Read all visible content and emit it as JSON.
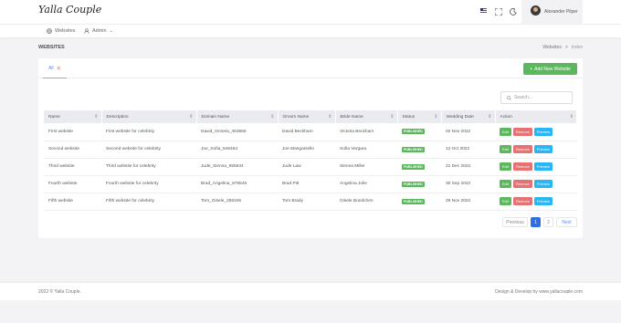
{
  "header": {
    "brand": "Yalla Couple",
    "user_name": "Alexander Pilper",
    "flag": "us-flag-icon"
  },
  "nav": {
    "websites": "Websites",
    "admin": "Admin"
  },
  "page": {
    "title": "WEBSITES",
    "breadcrumb": [
      "Websites",
      "Index"
    ]
  },
  "tabs": {
    "all_label": "All",
    "all_count": "5"
  },
  "add_button": "Add New Website",
  "search": {
    "placeholder": "Search..."
  },
  "table": {
    "columns": [
      "Name",
      "Description",
      "Domain Name",
      "Groom Name",
      "Bride Name",
      "Status",
      "Wedding Date",
      "Action"
    ],
    "rows": [
      {
        "name": "First website",
        "description": "First website for celebrity",
        "domain": "David_Victoria_453555",
        "groom": "David Beckham",
        "bride": "Victoria Beckham",
        "status": "PUBLISHED",
        "date": "02 Nov 2022"
      },
      {
        "name": "Second website",
        "description": "Second website for celebrity",
        "domain": "Joe_Sofia_546464",
        "groom": "Joe Manganiello",
        "bride": "Sofia Vergara",
        "status": "PUBLISHED",
        "date": "12 Oct 2022"
      },
      {
        "name": "Third website",
        "description": "Third website for celebrity",
        "domain": "Jude_Sienna_955634",
        "groom": "Jude Law",
        "bride": "Sienna Miller",
        "status": "PUBLISHED",
        "date": "21 Dec 2022"
      },
      {
        "name": "Fourth website",
        "description": "Fourth website for celebrity",
        "domain": "Brad_Angelina_876545",
        "groom": "Brad Pitt",
        "bride": "Angelina Jolie",
        "status": "PUBLISHED",
        "date": "30 Sep 2022"
      },
      {
        "name": "Fifth website",
        "description": "Fifth website for celebrity",
        "domain": "Tom_Gisele_256346",
        "groom": "Tom Brady",
        "bride": "Gisele Bundchen",
        "status": "PUBLISHED",
        "date": "29 Nov 2022"
      }
    ],
    "actions": {
      "edit": "Edit",
      "remove": "Remove",
      "preview": "Preview"
    }
  },
  "pagination": {
    "previous": "Previous",
    "pages": [
      "1",
      "2"
    ],
    "next": "Next",
    "current": "1"
  },
  "footer": {
    "left": "2022 © Yalla Couple.",
    "right": "Design & Develop by www.yallacouple.com"
  },
  "colors": {
    "primary": "#2f6fe0",
    "success": "#5cb85c",
    "danger": "#e57373",
    "info": "#29b6f6"
  }
}
